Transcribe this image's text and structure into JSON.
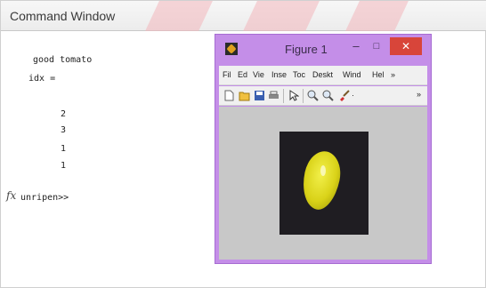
{
  "command_window": {
    "title": "Command Window",
    "output_lines": [
      "good tomato",
      "idx =",
      "2",
      "3",
      "1",
      "1"
    ],
    "prompt_symbol": "fx",
    "prompt_text": "unripen>>"
  },
  "figure": {
    "title": "Figure 1",
    "controls": {
      "minimize": "–",
      "maximize": "□",
      "close": "✕"
    },
    "menu": [
      "Fil",
      "Ed",
      "Vie",
      "Inse",
      "Toc",
      "Deskt",
      "Wind",
      "Hel"
    ],
    "menu_overflow": "»",
    "toolbar_overflow": "»",
    "icons": [
      "new-file-icon",
      "open-folder-icon",
      "save-icon",
      "print-icon",
      "pointer-icon",
      "zoom-in-icon",
      "zoom-out-icon",
      "brush-icon"
    ]
  },
  "colors": {
    "figure_frame": "#c48ee8",
    "close_button": "#d8453a",
    "canvas_bg": "#c8c8c8",
    "image_bg": "#1f1d22",
    "tomato": "#e6e025"
  }
}
